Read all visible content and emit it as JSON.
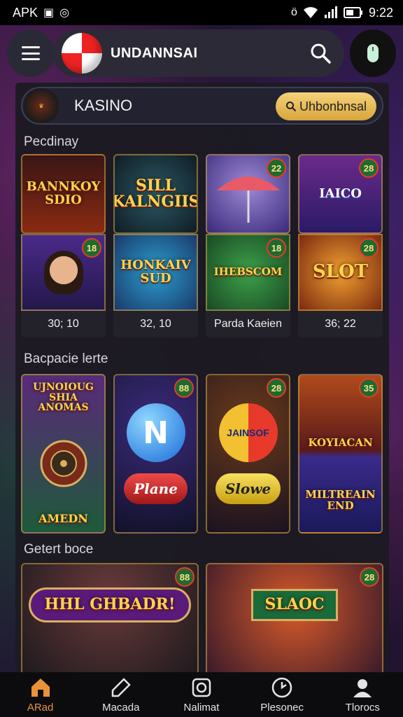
{
  "status_bar": {
    "left_text": "APK",
    "time": "9:22"
  },
  "header": {
    "title": "UNDANNSAI"
  },
  "casino_bar": {
    "label": "KASINO",
    "logo_text": "",
    "button_label": "Uhbonbnsal"
  },
  "sections": [
    {
      "title": "Pecdinay",
      "cards": [
        {
          "art_text": "BANNKOY SDIO",
          "badge": ""
        },
        {
          "art_text": "SILL KALNGIIS",
          "badge": ""
        },
        {
          "art_text": "",
          "badge": "22"
        },
        {
          "art_text": "IAICO",
          "badge": "28"
        },
        {
          "art_text": "",
          "badge": "18"
        },
        {
          "art_text": "HONKAIV SUD",
          "badge": ""
        },
        {
          "art_text": "IHEBSCOM",
          "badge": "18"
        },
        {
          "art_text": "SLOT",
          "badge": "28"
        }
      ],
      "captions": [
        "30; 10",
        "32, 10",
        "Parda Kaeien",
        "36; 22"
      ]
    },
    {
      "title": "Bacpacie lerte",
      "cards": [
        {
          "art_text": "UJNOIOUG SHIA ANOMAS",
          "art_text2": "AMEDN",
          "badge": ""
        },
        {
          "art_text": "N",
          "art_text2": "Plane",
          "badge": "88"
        },
        {
          "art_text": "JAINSOF",
          "art_text2": "Slowe",
          "badge": "28"
        },
        {
          "art_text": "KOYIACAN",
          "art_text2": "MILTREAIN END",
          "badge": "35"
        }
      ]
    },
    {
      "title": "Getert boce",
      "cards": [
        {
          "art_text": "HHL GHBADR!",
          "badge": "88"
        },
        {
          "art_text": "SLAOC",
          "badge": "28"
        }
      ]
    }
  ],
  "bottom_nav": [
    {
      "label": "ARad",
      "icon": "home-icon",
      "active": true
    },
    {
      "label": "Macada",
      "icon": "tag-icon",
      "active": false
    },
    {
      "label": "Nalimat",
      "icon": "square-icon",
      "active": false
    },
    {
      "label": "Plesonec",
      "icon": "clock-icon",
      "active": false
    },
    {
      "label": "Tlorocs",
      "icon": "user-icon",
      "active": false
    }
  ],
  "colors": {
    "accent_gold": "#d7a53d",
    "active_nav": "#e9923a",
    "badge_green": "#1d6b2e"
  }
}
